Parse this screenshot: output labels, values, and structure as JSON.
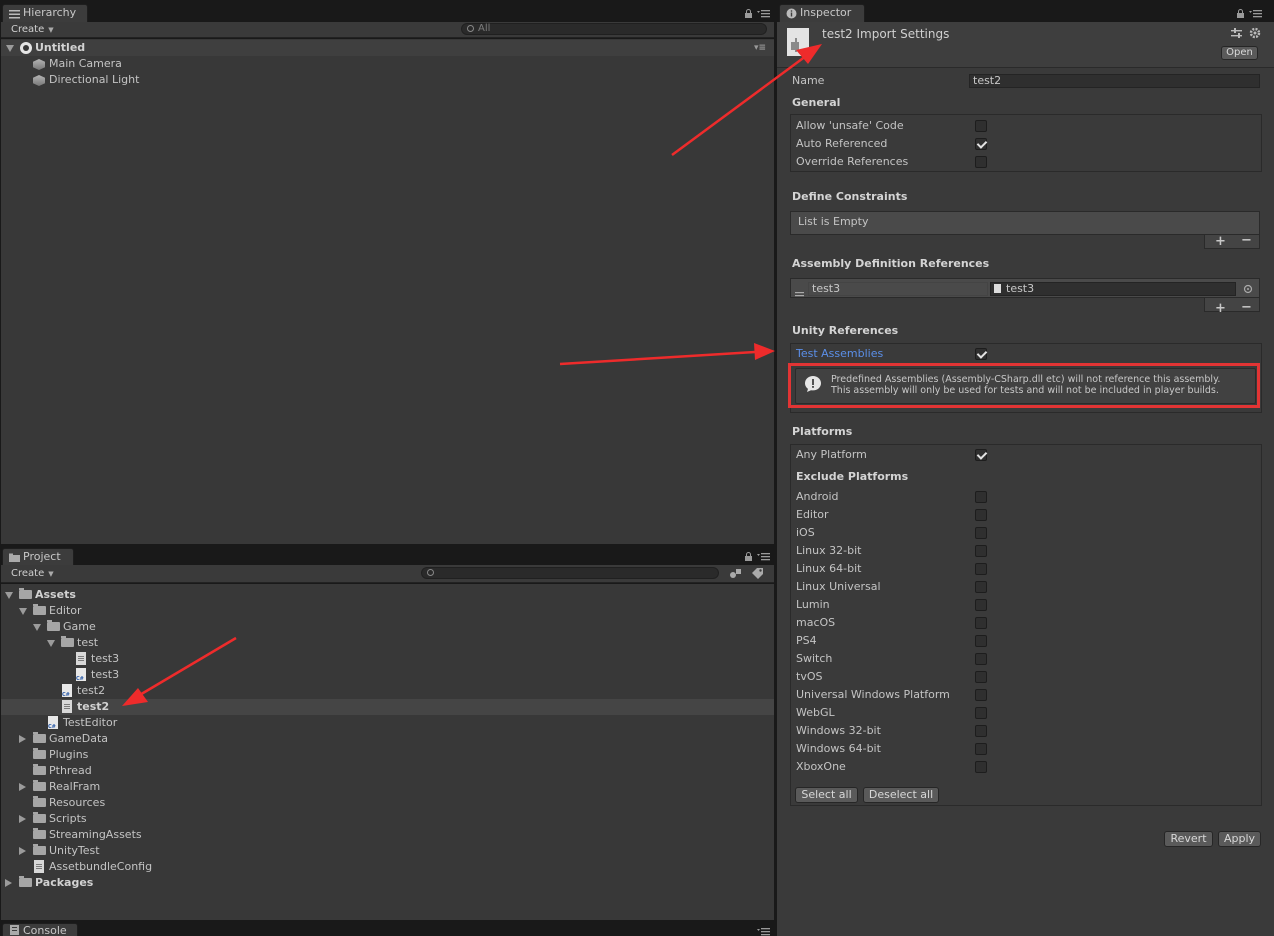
{
  "hierarchy": {
    "tab_label": "Hierarchy",
    "create_label": "Create",
    "search_placeholder": "All",
    "scene_name": "Untitled",
    "objects": [
      "Main Camera",
      "Directional Light"
    ]
  },
  "project": {
    "tab_label": "Project",
    "create_label": "Create",
    "tree": [
      {
        "label": "Assets",
        "depth": 0,
        "fold": "open",
        "icon": "folder",
        "bold": true
      },
      {
        "label": "Editor",
        "depth": 1,
        "fold": "open",
        "icon": "folder"
      },
      {
        "label": "Game",
        "depth": 2,
        "fold": "open",
        "icon": "folder"
      },
      {
        "label": "test",
        "depth": 3,
        "fold": "open",
        "icon": "folder"
      },
      {
        "label": "test3",
        "depth": 4,
        "fold": "none",
        "icon": "asmdef"
      },
      {
        "label": "test3",
        "depth": 4,
        "fold": "none",
        "icon": "cs"
      },
      {
        "label": "test2",
        "depth": 3,
        "fold": "none",
        "icon": "cs"
      },
      {
        "label": "test2",
        "depth": 3,
        "fold": "none",
        "icon": "asmdef",
        "selected": true,
        "bold": true
      },
      {
        "label": "TestEditor",
        "depth": 2,
        "fold": "none",
        "icon": "cs"
      },
      {
        "label": "GameData",
        "depth": 1,
        "fold": "closed",
        "icon": "folder"
      },
      {
        "label": "Plugins",
        "depth": 1,
        "fold": "none",
        "icon": "folder"
      },
      {
        "label": "Pthread",
        "depth": 1,
        "fold": "none",
        "icon": "folder"
      },
      {
        "label": "RealFram",
        "depth": 1,
        "fold": "closed",
        "icon": "folder"
      },
      {
        "label": "Resources",
        "depth": 1,
        "fold": "none",
        "icon": "folder"
      },
      {
        "label": "Scripts",
        "depth": 1,
        "fold": "closed",
        "icon": "folder"
      },
      {
        "label": "StreamingAssets",
        "depth": 1,
        "fold": "none",
        "icon": "folder"
      },
      {
        "label": "UnityTest",
        "depth": 1,
        "fold": "closed",
        "icon": "folder"
      },
      {
        "label": "AssetbundleConfig",
        "depth": 1,
        "fold": "none",
        "icon": "asset"
      },
      {
        "label": "Packages",
        "depth": 0,
        "fold": "closed",
        "icon": "folder",
        "bold": true
      }
    ]
  },
  "console": {
    "tab_label": "Console"
  },
  "inspector": {
    "tab_label": "Inspector",
    "title": "test2 Import Settings",
    "open_button": "Open",
    "name_label": "Name",
    "name_value": "test2",
    "general": {
      "heading": "General",
      "options": [
        {
          "label": "Allow 'unsafe' Code",
          "checked": false
        },
        {
          "label": "Auto Referenced",
          "checked": true
        },
        {
          "label": "Override References",
          "checked": false
        }
      ]
    },
    "define_constraints": {
      "heading": "Define Constraints",
      "empty_text": "List is Empty"
    },
    "assembly_refs": {
      "heading": "Assembly Definition References",
      "ref_name": "test3",
      "ref_object": "test3"
    },
    "unity_refs": {
      "heading": "Unity References",
      "test_assemblies_label": "Test Assemblies",
      "test_assemblies_checked": true,
      "warning_line1": "Predefined Assemblies (Assembly-CSharp.dll etc) will not reference this assembly.",
      "warning_line2": "This assembly will only be used for tests and will not be included in player builds."
    },
    "platforms": {
      "heading": "Platforms",
      "any_platform_label": "Any Platform",
      "any_platform_checked": true,
      "exclude_heading": "Exclude Platforms",
      "list": [
        "Android",
        "Editor",
        "iOS",
        "Linux 32-bit",
        "Linux 64-bit",
        "Linux Universal",
        "Lumin",
        "macOS",
        "PS4",
        "Switch",
        "tvOS",
        "Universal Windows Platform",
        "WebGL",
        "Windows 32-bit",
        "Windows 64-bit",
        "XboxOne"
      ],
      "select_all": "Select all",
      "deselect_all": "Deselect all"
    },
    "revert_button": "Revert",
    "apply_button": "Apply"
  },
  "colors": {
    "annotation": "#ee2b2b",
    "link_blue": "#5b8fe8",
    "panel": "#383838"
  }
}
